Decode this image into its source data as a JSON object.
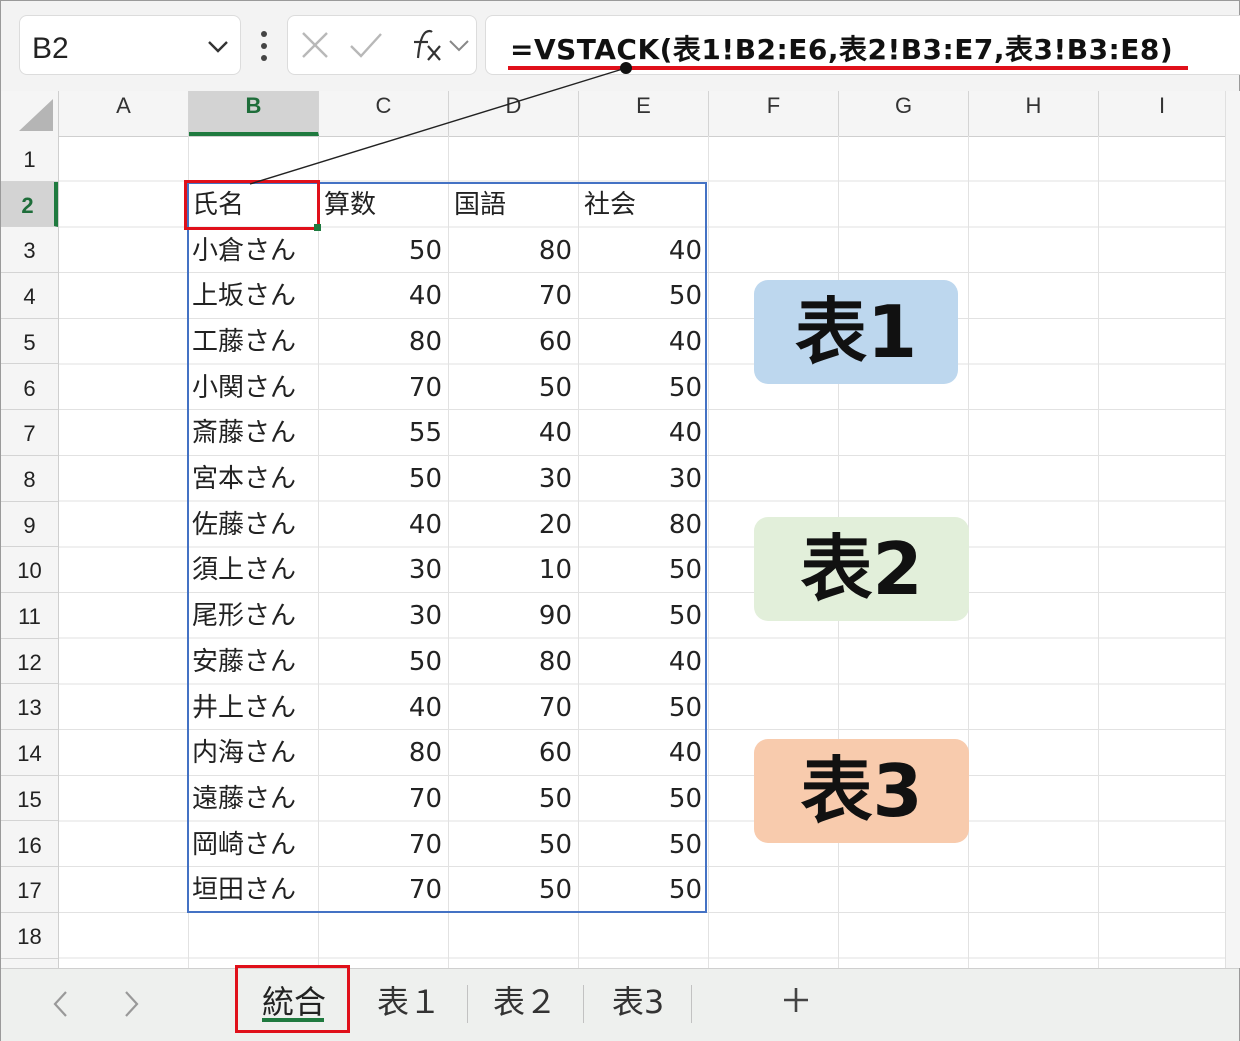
{
  "formula_bar": {
    "name_box": "B2",
    "formula": "=VSTACK(表1!B2:E6,表2!B3:E7,表3!B3:E8)"
  },
  "columns": [
    "A",
    "B",
    "C",
    "D",
    "E",
    "F",
    "G",
    "H",
    "I"
  ],
  "rows": [
    "1",
    "2",
    "3",
    "4",
    "5",
    "6",
    "7",
    "8",
    "9",
    "10",
    "11",
    "12",
    "13",
    "14",
    "15",
    "16",
    "17",
    "18"
  ],
  "table": {
    "headers": [
      "氏名",
      "算数",
      "国語",
      "社会"
    ],
    "rows": [
      [
        "小倉さん",
        "50",
        "80",
        "40"
      ],
      [
        "上坂さん",
        "40",
        "70",
        "50"
      ],
      [
        "工藤さん",
        "80",
        "60",
        "40"
      ],
      [
        "小関さん",
        "70",
        "50",
        "50"
      ],
      [
        "斎藤さん",
        "55",
        "40",
        "40"
      ],
      [
        "宮本さん",
        "50",
        "30",
        "30"
      ],
      [
        "佐藤さん",
        "40",
        "20",
        "80"
      ],
      [
        "須上さん",
        "30",
        "10",
        "50"
      ],
      [
        "尾形さん",
        "30",
        "90",
        "50"
      ],
      [
        "安藤さん",
        "50",
        "80",
        "40"
      ],
      [
        "井上さん",
        "40",
        "70",
        "50"
      ],
      [
        "内海さん",
        "80",
        "60",
        "40"
      ],
      [
        "遠藤さん",
        "70",
        "50",
        "50"
      ],
      [
        "岡崎さん",
        "70",
        "50",
        "50"
      ],
      [
        "垣田さん",
        "70",
        "50",
        "50"
      ]
    ]
  },
  "labels": [
    {
      "text": "表1",
      "color": "#bdd7ee"
    },
    {
      "text": "表2",
      "color": "#e2efda"
    },
    {
      "text": "表3",
      "color": "#f8cbad"
    }
  ],
  "tabs": {
    "items": [
      "統合",
      "表１",
      "表２",
      "表3"
    ],
    "active": 0
  },
  "colors": {
    "accent_green": "#1f7a3f",
    "annotation_red": "#e0101a",
    "table_border": "#4472c4"
  }
}
